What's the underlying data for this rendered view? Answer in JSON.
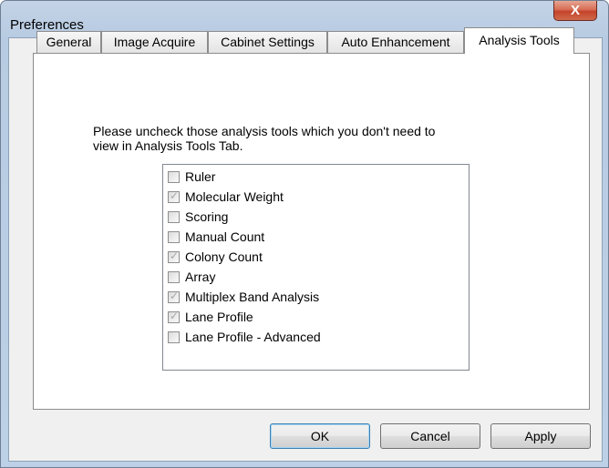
{
  "window": {
    "title": "Preferences",
    "close_glyph": "X"
  },
  "tabs": [
    {
      "label": "General",
      "active": false
    },
    {
      "label": "Image Acquire",
      "active": false
    },
    {
      "label": "Cabinet Settings",
      "active": false
    },
    {
      "label": "Auto Enhancement",
      "active": false
    },
    {
      "label": "Analysis Tools",
      "active": true
    }
  ],
  "panel": {
    "instructions_line1": "Please uncheck those analysis tools which you don't need to",
    "instructions_line2": "view in Analysis Tools Tab.",
    "tools": [
      {
        "label": "Ruler",
        "checked": false
      },
      {
        "label": "Molecular Weight",
        "checked": true
      },
      {
        "label": "Scoring",
        "checked": false
      },
      {
        "label": "Manual Count",
        "checked": false
      },
      {
        "label": "Colony Count",
        "checked": true
      },
      {
        "label": "Array",
        "checked": false
      },
      {
        "label": "Multiplex Band Analysis",
        "checked": true
      },
      {
        "label": "Lane Profile",
        "checked": true
      },
      {
        "label": "Lane Profile - Advanced",
        "checked": false
      }
    ]
  },
  "buttons": {
    "ok": "OK",
    "cancel": "Cancel",
    "apply": "Apply"
  },
  "colors": {
    "title_bar": "#b7cbe2",
    "close_button": "#c4432a",
    "dialog_bg": "#f0f0f0",
    "check_disabled": "#a8a8a8"
  }
}
